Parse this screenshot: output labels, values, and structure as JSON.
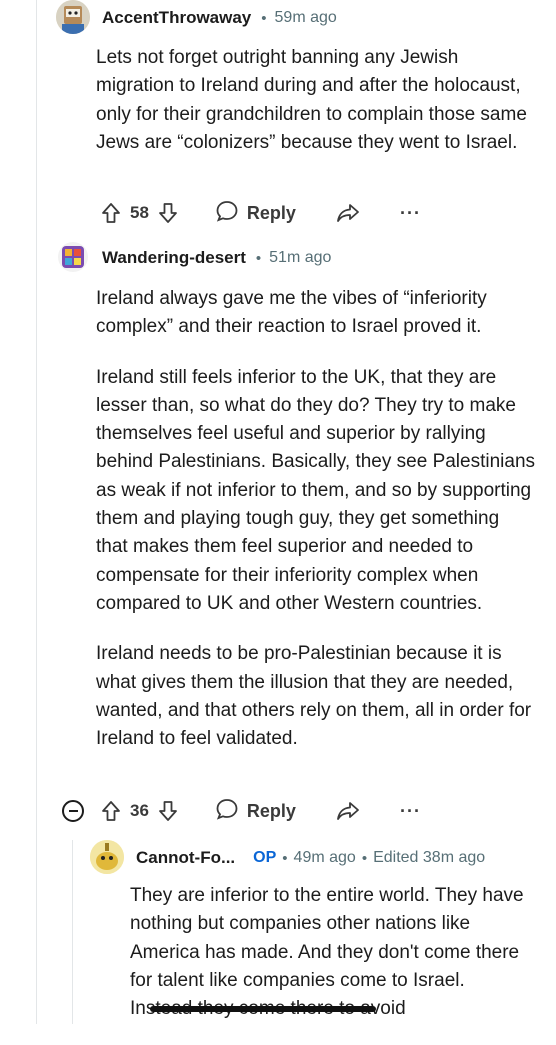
{
  "comments": [
    {
      "username": "AccentThrowaway",
      "time": "59m ago",
      "body": "Lets not forget outright banning any Jewish migration to Ireland during and after the holocaust, only for their grandchildren to complain those same Jews are “colonizers” because they went to Israel.",
      "score": "58",
      "reply_label": "Reply",
      "more_label": "···"
    },
    {
      "username": "Wandering-desert",
      "time": "51m ago",
      "paragraphs": [
        "Ireland always gave me the vibes of “inferiority complex” and their reaction to Israel proved it.",
        "Ireland still feels inferior to the UK, that they are lesser than, so what do they do? They try to make themselves feel useful and superior by rallying behind Palestinians. Basically, they see Palestinians as weak if not inferior to them, and so by supporting them and playing tough guy, they get something that makes them feel superior and needed to compensate for their inferiority complex when compared to UK and other Western countries.",
        "Ireland needs to be pro-Palestinian because it is what gives them the illusion that they are needed, wanted, and that others rely on them, all in order for Ireland to feel validated."
      ],
      "score": "36",
      "reply_label": "Reply",
      "more_label": "···"
    },
    {
      "username": "Cannot-Fo...",
      "op_badge": "OP",
      "time": "49m ago",
      "edited": "Edited 38m ago",
      "body": "They are inferior to the entire world. They have nothing but companies other nations like America has made. And they don't come there for talent like companies come to Israel. Instead they come there to avoid"
    }
  ],
  "separator": "•",
  "colors": {
    "meta": "#576f76",
    "op": "#0a66d6",
    "thread_line": "#e3e6e8"
  }
}
